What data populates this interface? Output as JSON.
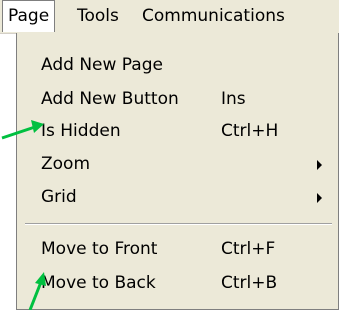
{
  "menubar": {
    "items": [
      "Page",
      "Tools",
      "Communications"
    ]
  },
  "menu": {
    "items": [
      {
        "label": "Add New Page",
        "shortcut": ""
      },
      {
        "label": "Add New Button",
        "shortcut": "Ins"
      },
      {
        "label": "Is Hidden",
        "shortcut": "Ctrl+H"
      },
      {
        "label": "Zoom",
        "shortcut": ""
      },
      {
        "label": "Grid",
        "shortcut": ""
      },
      {
        "label": "Move to Front",
        "shortcut": "Ctrl+F"
      },
      {
        "label": "Move to Back",
        "shortcut": "Ctrl+B"
      }
    ]
  },
  "colors": {
    "annotation_arrow": "#00c040",
    "menu_background": "#ece9d8"
  }
}
